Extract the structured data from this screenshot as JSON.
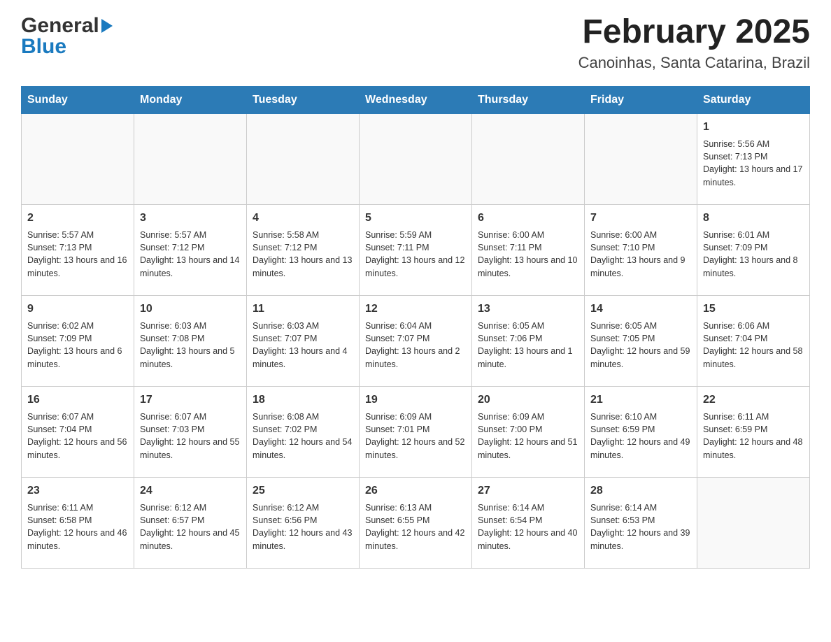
{
  "header": {
    "logo_general": "General",
    "logo_blue": "Blue",
    "month_title": "February 2025",
    "location": "Canoinhas, Santa Catarina, Brazil"
  },
  "days_of_week": [
    "Sunday",
    "Monday",
    "Tuesday",
    "Wednesday",
    "Thursday",
    "Friday",
    "Saturday"
  ],
  "weeks": [
    [
      {
        "day": "",
        "info": ""
      },
      {
        "day": "",
        "info": ""
      },
      {
        "day": "",
        "info": ""
      },
      {
        "day": "",
        "info": ""
      },
      {
        "day": "",
        "info": ""
      },
      {
        "day": "",
        "info": ""
      },
      {
        "day": "1",
        "info": "Sunrise: 5:56 AM\nSunset: 7:13 PM\nDaylight: 13 hours and 17 minutes."
      }
    ],
    [
      {
        "day": "2",
        "info": "Sunrise: 5:57 AM\nSunset: 7:13 PM\nDaylight: 13 hours and 16 minutes."
      },
      {
        "day": "3",
        "info": "Sunrise: 5:57 AM\nSunset: 7:12 PM\nDaylight: 13 hours and 14 minutes."
      },
      {
        "day": "4",
        "info": "Sunrise: 5:58 AM\nSunset: 7:12 PM\nDaylight: 13 hours and 13 minutes."
      },
      {
        "day": "5",
        "info": "Sunrise: 5:59 AM\nSunset: 7:11 PM\nDaylight: 13 hours and 12 minutes."
      },
      {
        "day": "6",
        "info": "Sunrise: 6:00 AM\nSunset: 7:11 PM\nDaylight: 13 hours and 10 minutes."
      },
      {
        "day": "7",
        "info": "Sunrise: 6:00 AM\nSunset: 7:10 PM\nDaylight: 13 hours and 9 minutes."
      },
      {
        "day": "8",
        "info": "Sunrise: 6:01 AM\nSunset: 7:09 PM\nDaylight: 13 hours and 8 minutes."
      }
    ],
    [
      {
        "day": "9",
        "info": "Sunrise: 6:02 AM\nSunset: 7:09 PM\nDaylight: 13 hours and 6 minutes."
      },
      {
        "day": "10",
        "info": "Sunrise: 6:03 AM\nSunset: 7:08 PM\nDaylight: 13 hours and 5 minutes."
      },
      {
        "day": "11",
        "info": "Sunrise: 6:03 AM\nSunset: 7:07 PM\nDaylight: 13 hours and 4 minutes."
      },
      {
        "day": "12",
        "info": "Sunrise: 6:04 AM\nSunset: 7:07 PM\nDaylight: 13 hours and 2 minutes."
      },
      {
        "day": "13",
        "info": "Sunrise: 6:05 AM\nSunset: 7:06 PM\nDaylight: 13 hours and 1 minute."
      },
      {
        "day": "14",
        "info": "Sunrise: 6:05 AM\nSunset: 7:05 PM\nDaylight: 12 hours and 59 minutes."
      },
      {
        "day": "15",
        "info": "Sunrise: 6:06 AM\nSunset: 7:04 PM\nDaylight: 12 hours and 58 minutes."
      }
    ],
    [
      {
        "day": "16",
        "info": "Sunrise: 6:07 AM\nSunset: 7:04 PM\nDaylight: 12 hours and 56 minutes."
      },
      {
        "day": "17",
        "info": "Sunrise: 6:07 AM\nSunset: 7:03 PM\nDaylight: 12 hours and 55 minutes."
      },
      {
        "day": "18",
        "info": "Sunrise: 6:08 AM\nSunset: 7:02 PM\nDaylight: 12 hours and 54 minutes."
      },
      {
        "day": "19",
        "info": "Sunrise: 6:09 AM\nSunset: 7:01 PM\nDaylight: 12 hours and 52 minutes."
      },
      {
        "day": "20",
        "info": "Sunrise: 6:09 AM\nSunset: 7:00 PM\nDaylight: 12 hours and 51 minutes."
      },
      {
        "day": "21",
        "info": "Sunrise: 6:10 AM\nSunset: 6:59 PM\nDaylight: 12 hours and 49 minutes."
      },
      {
        "day": "22",
        "info": "Sunrise: 6:11 AM\nSunset: 6:59 PM\nDaylight: 12 hours and 48 minutes."
      }
    ],
    [
      {
        "day": "23",
        "info": "Sunrise: 6:11 AM\nSunset: 6:58 PM\nDaylight: 12 hours and 46 minutes."
      },
      {
        "day": "24",
        "info": "Sunrise: 6:12 AM\nSunset: 6:57 PM\nDaylight: 12 hours and 45 minutes."
      },
      {
        "day": "25",
        "info": "Sunrise: 6:12 AM\nSunset: 6:56 PM\nDaylight: 12 hours and 43 minutes."
      },
      {
        "day": "26",
        "info": "Sunrise: 6:13 AM\nSunset: 6:55 PM\nDaylight: 12 hours and 42 minutes."
      },
      {
        "day": "27",
        "info": "Sunrise: 6:14 AM\nSunset: 6:54 PM\nDaylight: 12 hours and 40 minutes."
      },
      {
        "day": "28",
        "info": "Sunrise: 6:14 AM\nSunset: 6:53 PM\nDaylight: 12 hours and 39 minutes."
      },
      {
        "day": "",
        "info": ""
      }
    ]
  ]
}
